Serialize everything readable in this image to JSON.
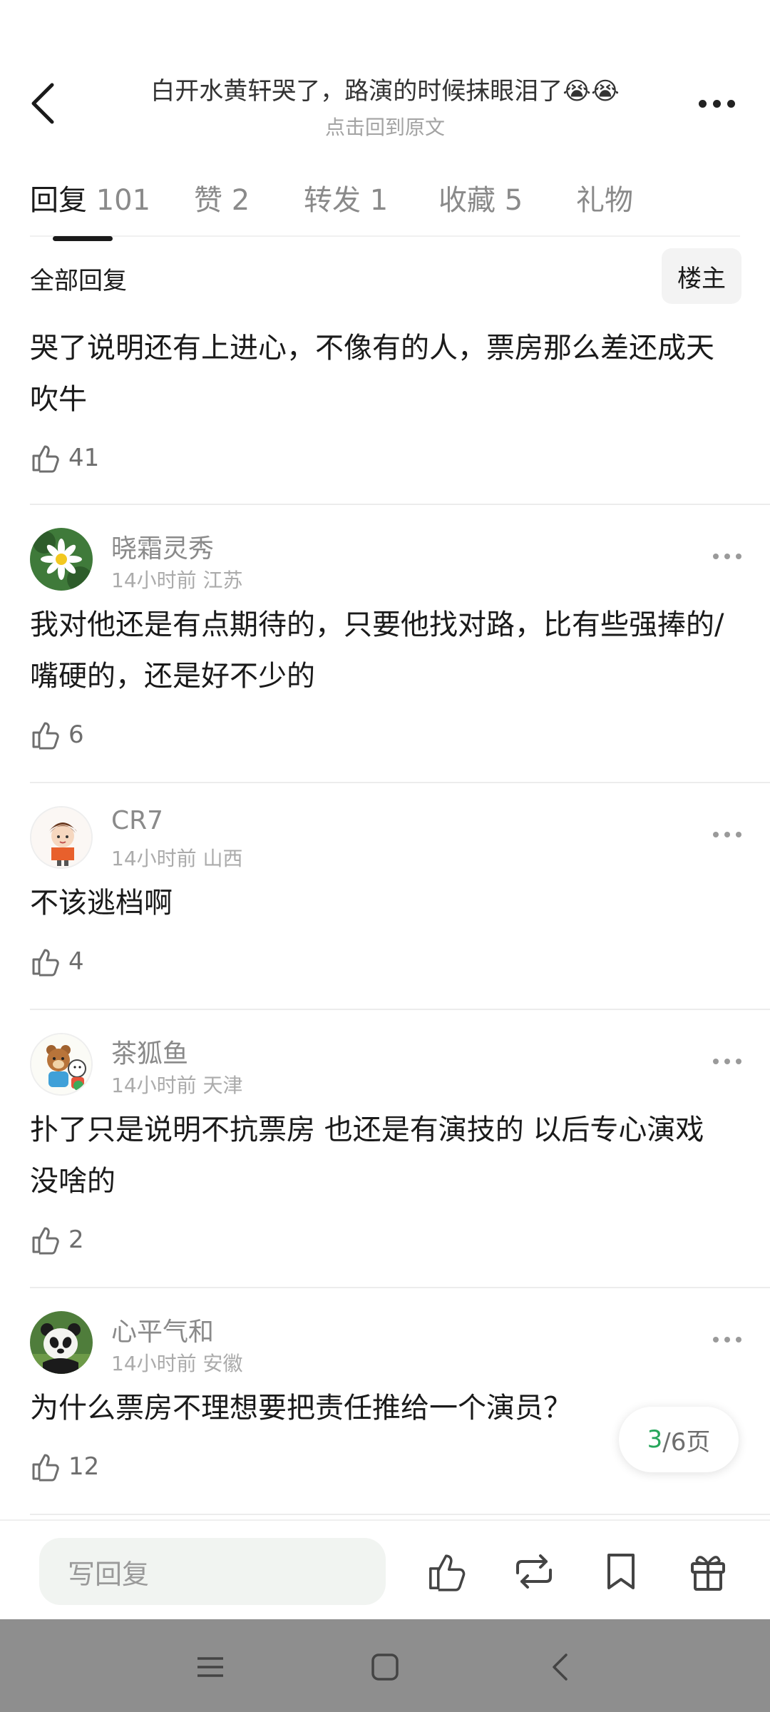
{
  "header": {
    "title": "白开水黄轩哭了，路演的时候抹眼泪了😭😭",
    "subtitle": "点击回到原文"
  },
  "tabs": [
    {
      "label": "回复",
      "count": "101"
    },
    {
      "label": "赞",
      "count": "2"
    },
    {
      "label": "转发",
      "count": "1"
    },
    {
      "label": "收藏",
      "count": "5"
    },
    {
      "label": "礼物",
      "count": ""
    }
  ],
  "filter": {
    "label": "全部回复",
    "op_button": "楼主"
  },
  "comments": [
    {
      "user": "",
      "time": "",
      "location": "",
      "text": "哭了说明还有上进心，不像有的人，票房那么差还成天吹牛",
      "likes": "41"
    },
    {
      "user": "晓霜灵秀",
      "time": "14小时前",
      "location": "江苏",
      "text": "我对他还是有点期待的，只要他找对路，比有些强捧的/嘴硬的，还是好不少的",
      "likes": "6",
      "avatar": "daisy-avatar"
    },
    {
      "user": "CR7",
      "time": "14小时前",
      "location": "山西",
      "text": "不该逃档啊",
      "likes": "4",
      "avatar": "cartoon-boy-avatar"
    },
    {
      "user": "茶狐鱼",
      "time": "14小时前",
      "location": "天津",
      "text": "扑了只是说明不抗票房 也还是有演技的 以后专心演戏没啥的",
      "likes": "2",
      "avatar": "cartoon-bear-avatar"
    },
    {
      "user": "心平气和",
      "time": "14小时前",
      "location": "安徽",
      "text": "为什么票房不理想要把责任推给一个演员？",
      "likes": "12",
      "avatar": "panda-avatar"
    }
  ],
  "pagination": {
    "current": "3",
    "total_text": "/6页"
  },
  "bottom_bar": {
    "reply_placeholder": "写回复"
  },
  "colors": {
    "accent_green": "#26a65b",
    "text_primary": "#1a1a1a",
    "text_secondary": "#8a8a8a",
    "system_nav": "#8e8e8e"
  }
}
